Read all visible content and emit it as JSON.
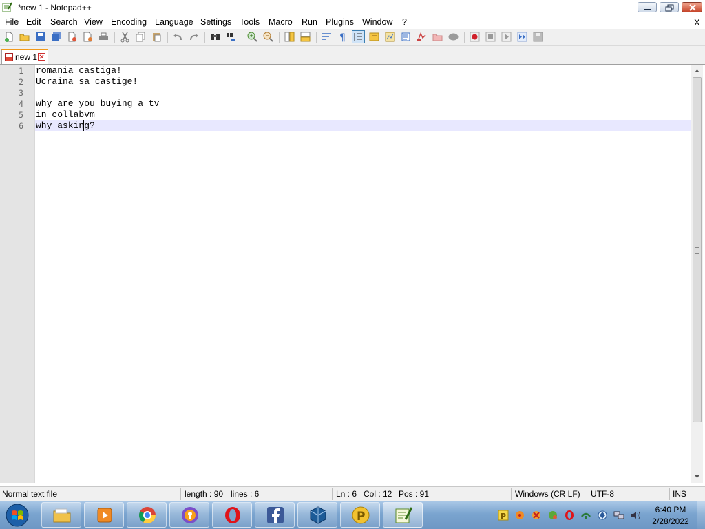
{
  "window": {
    "title": "*new 1 - Notepad++"
  },
  "menu": {
    "items": [
      "File",
      "Edit",
      "Search",
      "View",
      "Encoding",
      "Language",
      "Settings",
      "Tools",
      "Macro",
      "Run",
      "Plugins",
      "Window",
      "?"
    ],
    "close_x": "X"
  },
  "toolbar": {
    "icons": [
      "new-file-icon",
      "open-file-icon",
      "save-icon",
      "save-all-icon",
      "close-icon",
      "close-all-icon",
      "print-icon",
      "cut-icon",
      "copy-icon",
      "paste-icon",
      "undo-icon",
      "redo-icon",
      "find-icon",
      "replace-icon",
      "zoom-in-icon",
      "zoom-out-icon",
      "sync-vertical-icon",
      "sync-horizontal-icon",
      "word-wrap-icon",
      "show-all-chars-icon",
      "indent-guide-icon",
      "udl-icon",
      "doc-map-icon",
      "function-list-icon",
      "folder-as-workspace-icon",
      "monitoring-icon",
      "record-macro-icon",
      "stop-record-icon",
      "play-macro-icon",
      "run-macro-multiple-icon",
      "save-macro-icon"
    ]
  },
  "tabs": [
    {
      "label": "new 1",
      "modified": true
    }
  ],
  "editor": {
    "lines": [
      {
        "num": "1",
        "text": "romania castiga!"
      },
      {
        "num": "2",
        "text": "Ucraina sa castige!"
      },
      {
        "num": "3",
        "text": ""
      },
      {
        "num": "4",
        "text": "why are you buying a tv"
      },
      {
        "num": "5",
        "text": "in collabvm"
      },
      {
        "num": "6",
        "text": "why asking?"
      }
    ],
    "current_line": 6
  },
  "status": {
    "file_type": "Normal text file",
    "length": "length : 90",
    "lines": "lines : 6",
    "ln": "Ln : 6",
    "col": "Col : 12",
    "pos": "Pos : 91",
    "eol": "Windows (CR LF)",
    "encoding": "UTF-8",
    "mode": "INS"
  },
  "taskbar": {
    "pinned": [
      "file-explorer-icon",
      "media-player-icon",
      "chrome-icon",
      "brave-icon",
      "opera-icon",
      "facebook-icon",
      "virtualbox-icon",
      "paint-icon",
      "notepad-plus-plus-icon"
    ],
    "tray_icons": [
      "p-app-tray-icon",
      "tray-app-icon",
      "tray-app-icon-2",
      "tray-app-icon-3",
      "opera-tray-icon",
      "tray-app-icon-4",
      "tray-app-icon-5",
      "network-icon",
      "volume-icon"
    ],
    "time": "6:40 PM",
    "date": "2/28/2022"
  },
  "colors": {
    "accent_tab": "#f29a1a",
    "current_line": "#e8e8ff",
    "gutter": "#e4e4e4",
    "taskbar": "#7aa4cf"
  }
}
